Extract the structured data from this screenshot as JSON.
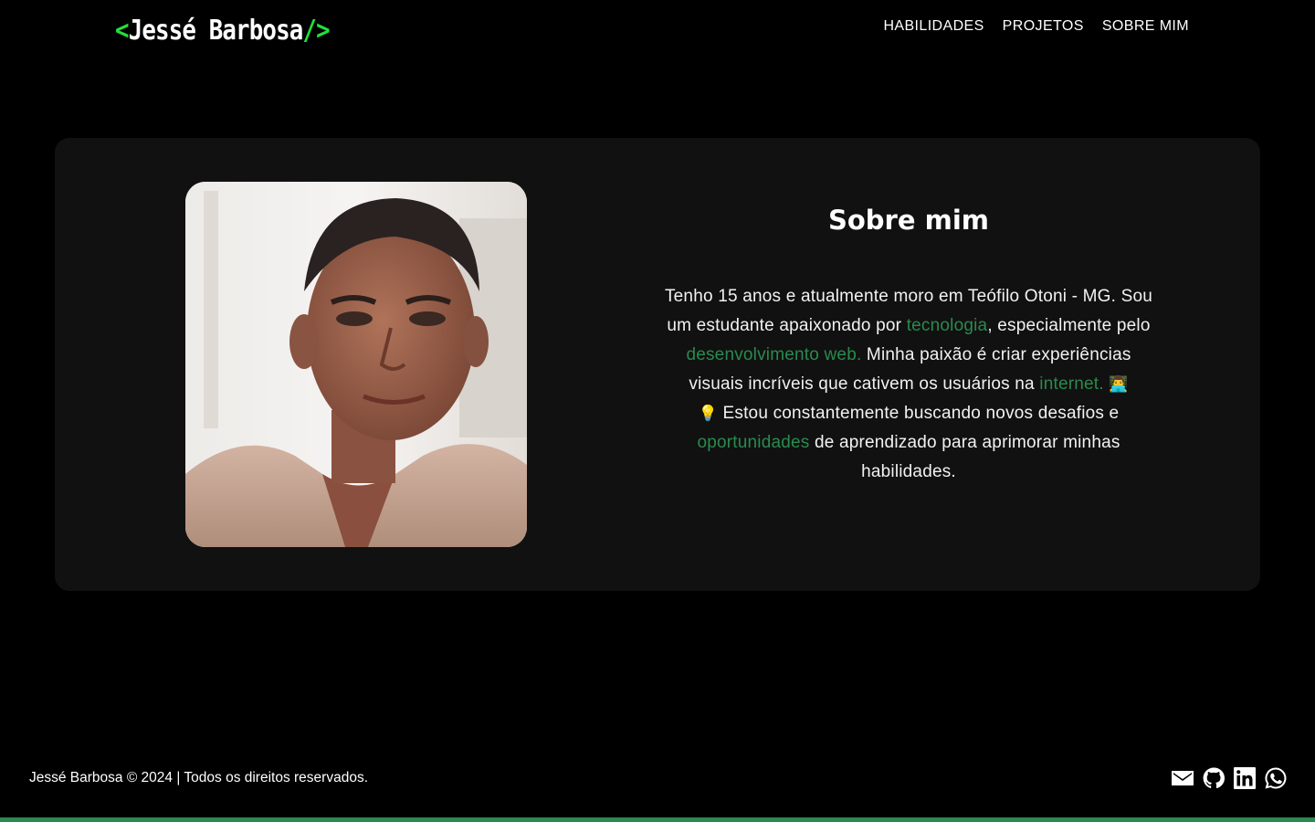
{
  "header": {
    "logo": {
      "open": "<",
      "name": "Jessé Barbosa",
      "close": "/>"
    },
    "nav": [
      "HABILIDADES",
      "PROJETOS",
      "SOBRE MIM"
    ]
  },
  "about": {
    "title": "Sobre mim",
    "photo_alt": "Foto de Jessé Barbosa",
    "text": {
      "p1": "Tenho 15 anos e atualmente moro em Teófilo Otoni - MG. Sou um estudante apaixonado por ",
      "h1": "tecnologia",
      "p2": ", especialmente pelo ",
      "h2": "desenvolvimento web.",
      "p3": " Minha paixão é criar experiências visuais incríveis que cativem os usuários na ",
      "h3": "internet.",
      "emoji1": "👨‍💻",
      "emoji2": "💡",
      "p4": " Estou constantemente buscando novos desafios e ",
      "h4": "oportunidades",
      "p5": " de aprendizado para aprimorar minhas habilidades."
    }
  },
  "footer": {
    "text": "Jessé Barbosa © 2024 | Todos os direitos reservados.",
    "icons": [
      "email-icon",
      "github-icon",
      "linkedin-icon",
      "whatsapp-icon"
    ]
  },
  "colors": {
    "accent": "#22e03a",
    "highlight": "#2a8a4e",
    "card": "#111111",
    "background": "#000000",
    "bottom_line": "#2b8a52"
  }
}
